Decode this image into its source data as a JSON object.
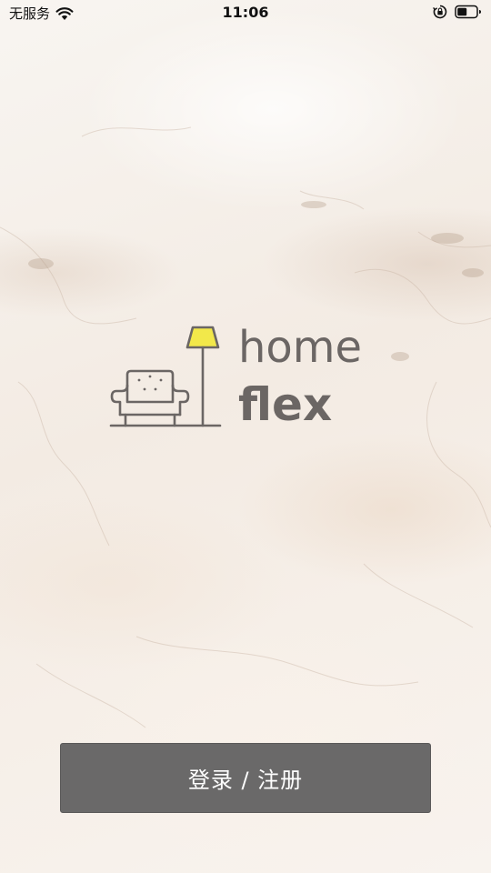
{
  "status_bar": {
    "carrier": "无服务",
    "time": "11:06"
  },
  "logo": {
    "word_top": "home",
    "word_bottom": "flex",
    "icon": "sofa-and-floor-lamp-icon",
    "colors": {
      "text": "#6b6664",
      "lamp_shade": "#f2e84a"
    }
  },
  "login_button": {
    "label": "登录 / 注册",
    "background": "#6a6969"
  }
}
